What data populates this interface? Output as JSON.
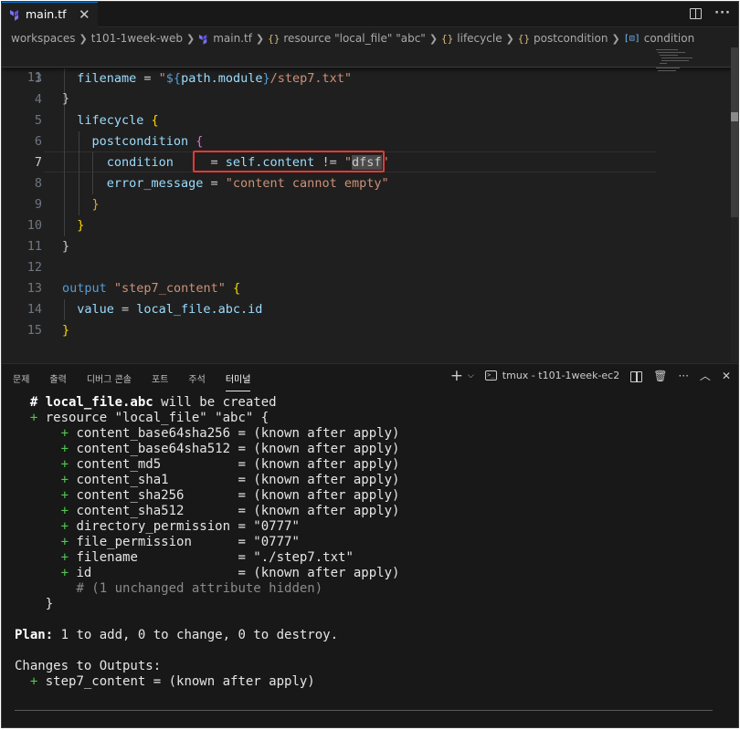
{
  "tab": {
    "label": "main.tf",
    "close": "✕"
  },
  "breadcrumb": {
    "items": [
      "workspaces",
      "t101-1week-web",
      "main.tf",
      "resource \"local_file\" \"abc\"",
      "lifecycle",
      "postcondition",
      "condition"
    ]
  },
  "editor": {
    "sticky": {
      "num": "11",
      "text": "}"
    },
    "lines": [
      {
        "num": "3",
        "tokens": [
          [
            "k",
            "filename"
          ],
          [
            "p",
            " = "
          ],
          [
            "s",
            "\""
          ],
          [
            "tmpl",
            "${"
          ],
          [
            "fnc",
            "path.module"
          ],
          [
            "tmpl",
            "}"
          ],
          [
            "s",
            "/step7.txt\""
          ]
        ]
      },
      {
        "num": "4",
        "tokens": []
      },
      {
        "num": "5",
        "tokens": [
          [
            "k",
            "lifecycle"
          ],
          [
            "p",
            " "
          ],
          [
            "br1",
            "{"
          ]
        ]
      },
      {
        "num": "6",
        "tokens": [
          [
            "k",
            "postcondition"
          ],
          [
            "p",
            " "
          ],
          [
            "br2",
            "{"
          ]
        ]
      },
      {
        "num": "7",
        "tokens": [
          [
            "k",
            "condition"
          ],
          [
            "p",
            "     = "
          ],
          [
            "k",
            "self.content"
          ],
          [
            "p",
            " != "
          ],
          [
            "s",
            "\""
          ],
          [
            "hl",
            "dfsf"
          ],
          [
            "s",
            "\""
          ]
        ]
      },
      {
        "num": "8",
        "tokens": [
          [
            "k",
            "error_message"
          ],
          [
            "p",
            " = "
          ],
          [
            "s",
            "\"content cannot empty\""
          ]
        ]
      },
      {
        "num": "9",
        "tokens": [
          [
            "br3",
            "}"
          ]
        ]
      },
      {
        "num": "10",
        "tokens": [
          [
            "br1",
            "}"
          ]
        ]
      },
      {
        "num": "11",
        "tokens": [
          [
            "p",
            "}"
          ]
        ]
      },
      {
        "num": "12",
        "tokens": []
      },
      {
        "num": "13",
        "tokens": [
          [
            "kw",
            "output"
          ],
          [
            "p",
            " "
          ],
          [
            "s",
            "\"step7_content\""
          ],
          [
            "p",
            " "
          ],
          [
            "br1",
            "{"
          ]
        ]
      },
      {
        "num": "14",
        "tokens": [
          [
            "k",
            "value"
          ],
          [
            "p",
            " = "
          ],
          [
            "k",
            "local_file.abc.id"
          ]
        ]
      },
      {
        "num": "15",
        "tokens": [
          [
            "br1",
            "}"
          ]
        ]
      }
    ]
  },
  "panel": {
    "tabs": [
      "문제",
      "출력",
      "디버그 콘솔",
      "포트",
      "주석",
      "터미널"
    ],
    "active_tab": "터미널",
    "terminal_name": "tmux - t101-1week-ec2"
  },
  "terminal": {
    "lines": [
      [
        [
          "p",
          "  "
        ],
        [
          "b",
          "# local_file.abc"
        ],
        [
          "p",
          " will be created"
        ]
      ],
      [
        [
          "p",
          "  "
        ],
        [
          "g",
          "+"
        ],
        [
          "p",
          " resource \"local_file\" \"abc\" {"
        ]
      ],
      [
        [
          "p",
          "      "
        ],
        [
          "g",
          "+"
        ],
        [
          "p",
          " content_base64sha256 = (known after apply)"
        ]
      ],
      [
        [
          "p",
          "      "
        ],
        [
          "g",
          "+"
        ],
        [
          "p",
          " content_base64sha512 = (known after apply)"
        ]
      ],
      [
        [
          "p",
          "      "
        ],
        [
          "g",
          "+"
        ],
        [
          "p",
          " content_md5          = (known after apply)"
        ]
      ],
      [
        [
          "p",
          "      "
        ],
        [
          "g",
          "+"
        ],
        [
          "p",
          " content_sha1         = (known after apply)"
        ]
      ],
      [
        [
          "p",
          "      "
        ],
        [
          "g",
          "+"
        ],
        [
          "p",
          " content_sha256       = (known after apply)"
        ]
      ],
      [
        [
          "p",
          "      "
        ],
        [
          "g",
          "+"
        ],
        [
          "p",
          " content_sha512       = (known after apply)"
        ]
      ],
      [
        [
          "p",
          "      "
        ],
        [
          "g",
          "+"
        ],
        [
          "p",
          " directory_permission = \"0777\""
        ]
      ],
      [
        [
          "p",
          "      "
        ],
        [
          "g",
          "+"
        ],
        [
          "p",
          " file_permission      = \"0777\""
        ]
      ],
      [
        [
          "p",
          "      "
        ],
        [
          "g",
          "+"
        ],
        [
          "p",
          " filename             = \"./step7.txt\""
        ]
      ],
      [
        [
          "p",
          "      "
        ],
        [
          "g",
          "+"
        ],
        [
          "p",
          " id                   = (known after apply)"
        ]
      ],
      [
        [
          "p",
          "        "
        ],
        [
          "d",
          "# (1 unchanged attribute hidden)"
        ]
      ],
      [
        [
          "p",
          "    }"
        ]
      ],
      [],
      [
        [
          "b",
          "Plan:"
        ],
        [
          "p",
          " 1 to add, 0 to change, 0 to destroy."
        ]
      ],
      [],
      [
        [
          "p",
          "Changes to Outputs:"
        ]
      ],
      [
        [
          "p",
          "  "
        ],
        [
          "g",
          "+"
        ],
        [
          "p",
          " step7_content = (known after apply)"
        ]
      ]
    ]
  },
  "colors": {
    "accent": "#0078d4",
    "highlight_box": "#e53935",
    "terminal_plus": "#4ec94e"
  }
}
